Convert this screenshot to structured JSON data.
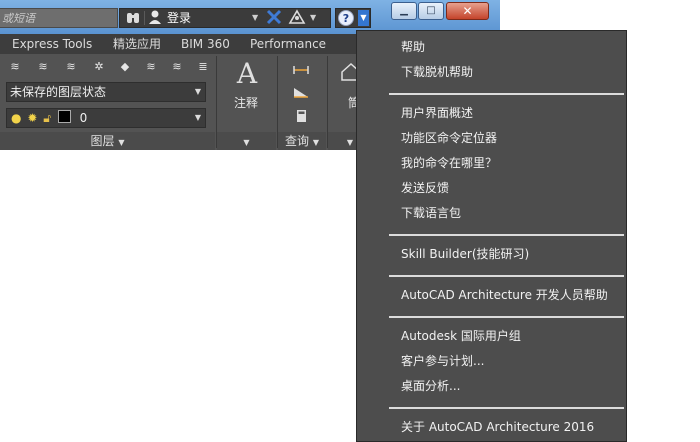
{
  "titlebar": {
    "search_placeholder": "或短语",
    "signin_label": "登录",
    "icons": [
      "binoculars-icon",
      "user-icon",
      "exchange-x-icon",
      "a360-icon",
      "help-icon"
    ]
  },
  "ribbon": {
    "tabs": [
      "Express Tools",
      "精选应用",
      "BIM 360",
      "Performance"
    ],
    "layer_state_value": "未保存的图层状态",
    "layer_name_value": "0",
    "layers_panel_label": "图层",
    "annotate_label": "注释",
    "query_label": "查询",
    "extra_panel_label_partial": "筒"
  },
  "menu": {
    "groups": [
      [
        "帮助",
        "下载脱机帮助"
      ],
      [
        "用户界面概述",
        "功能区命令定位器",
        "我的命令在哪里？",
        "发送反馈",
        "下载语言包"
      ],
      [
        "Skill Builder(技能研习)"
      ],
      [
        "AutoCAD Architecture 开发人员帮助"
      ],
      [
        "Autodesk 国际用户组",
        "客户参与计划...",
        "桌面分析..."
      ],
      [
        "关于 AutoCAD Architecture 2016"
      ]
    ]
  },
  "colors": {
    "menu_bg": "#4d4d4d",
    "ribbon_bg": "#535353",
    "titlebar_blue": "#6ea3da",
    "close_red": "#c4442b"
  }
}
